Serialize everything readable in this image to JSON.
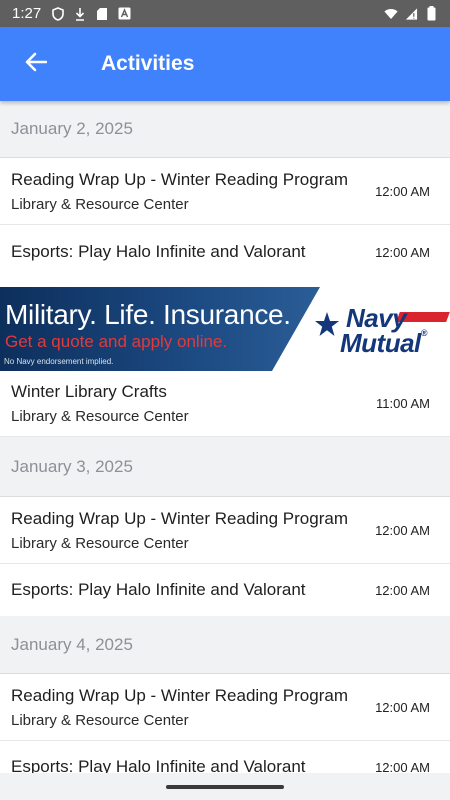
{
  "status_bar": {
    "time": "1:27",
    "icons": [
      "shield-icon",
      "download-icon",
      "sd-card-icon",
      "font-a-icon"
    ],
    "right_icons": [
      "wifi-icon",
      "signal-icon",
      "battery-icon"
    ]
  },
  "app_bar": {
    "title": "Activities",
    "back_icon": "arrow-left-icon"
  },
  "colors": {
    "app_bar": "#3f82fc",
    "status_bar": "#5f5f5f",
    "ad_red": "#e23a3a",
    "ad_blue": "#13377a"
  },
  "ad": {
    "headline": "Military. Life. Insurance.",
    "subline": "Get a quote and apply online.",
    "disclaimer": "No Navy endorsement implied.",
    "logo_line1": "Navy",
    "logo_line2": "Mutual",
    "logo_mark": "®"
  },
  "sections": [
    {
      "date": "January 2, 2025",
      "items": [
        {
          "title": "Reading Wrap Up - Winter Reading Program",
          "location": "Library & Resource Center",
          "time": "12:00 AM"
        },
        {
          "title": "Esports: Play Halo Infinite and Valorant",
          "location": "",
          "time": "12:00 AM"
        },
        {
          "title": "Winter Library Crafts",
          "location": "Library & Resource Center",
          "time": "11:00 AM"
        }
      ]
    },
    {
      "date": "January 3, 2025",
      "items": [
        {
          "title": "Reading Wrap Up - Winter Reading Program",
          "location": "Library & Resource Center",
          "time": "12:00 AM"
        },
        {
          "title": "Esports: Play Halo Infinite and Valorant",
          "location": "",
          "time": "12:00 AM"
        }
      ]
    },
    {
      "date": "January 4, 2025",
      "items": [
        {
          "title": "Reading Wrap Up - Winter Reading Program",
          "location": "Library & Resource Center",
          "time": "12:00 AM"
        },
        {
          "title": "Esports: Play Halo Infinite and Valorant",
          "location": "",
          "time": "12:00 AM"
        }
      ]
    }
  ]
}
